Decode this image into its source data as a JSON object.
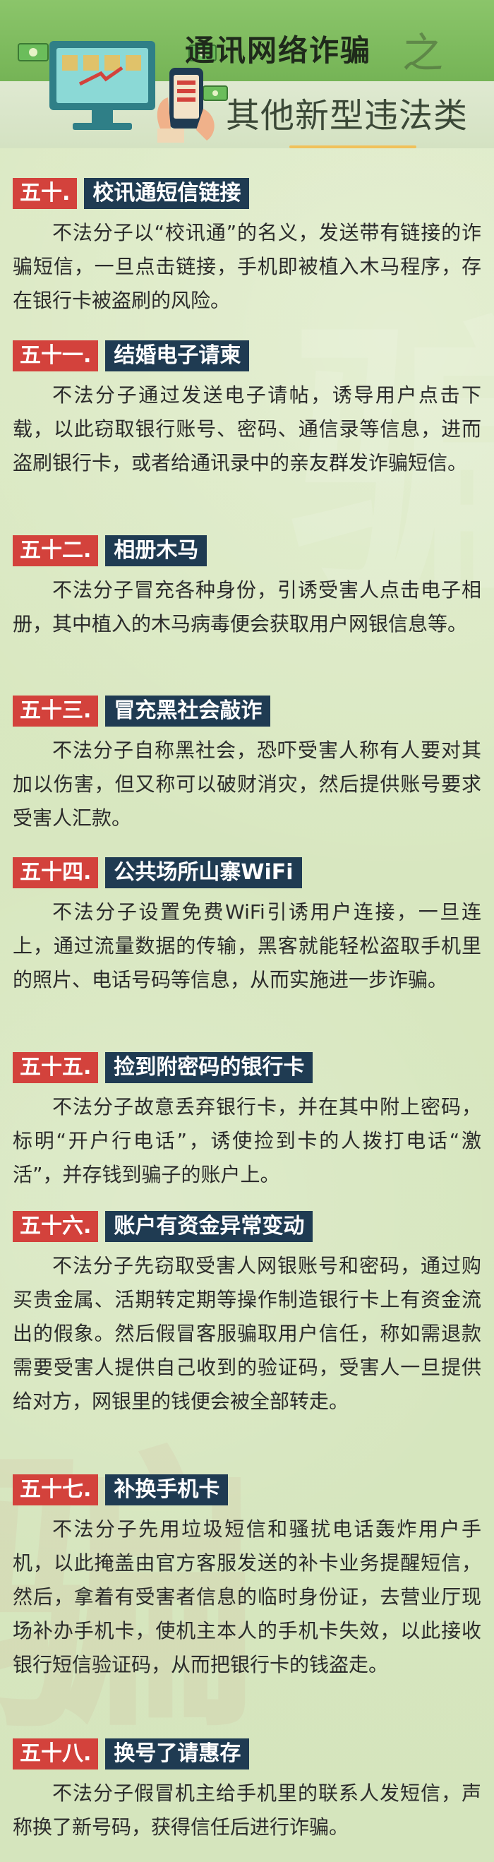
{
  "header": {
    "title_line_1": "通讯网络诈骗",
    "title_decor": "之",
    "title_line_2": "其他新型违法类"
  },
  "sections": [
    {
      "number": "五十.",
      "title": "校讯通短信链接",
      "body": "不法分子以“校讯通”的名义，发送带有链接的诈骗短信，一旦点击链接，手机即被植入木马程序，存在银行卡被盗刷的风险。"
    },
    {
      "number": "五十一.",
      "title": "结婚电子请柬",
      "body": "不法分子通过发送电子请帖，诱导用户点击下载，以此窃取银行账号、密码、通信录等信息，进而盗刷银行卡，或者给通讯录中的亲友群发诈骗短信。"
    },
    {
      "number": "五十二.",
      "title": "相册木马",
      "body": "不法分子冒充各种身份，引诱受害人点击电子相册，其中植入的木马病毒便会获取用户网银信息等。"
    },
    {
      "number": "五十三.",
      "title": "冒充黑社会敲诈",
      "body": "不法分子自称黑社会，恐吓受害人称有人要对其加以伤害，但又称可以破财消灾，然后提供账号要求受害人汇款。"
    },
    {
      "number": "五十四.",
      "title": "公共场所山寨WiFi",
      "body": "不法分子设置免费WiFi引诱用户连接，一旦连上，通过流量数据的传输，黑客就能轻松盗取手机里的照片、电话号码等信息，从而实施进一步诈骗。"
    },
    {
      "number": "五十五.",
      "title": "捡到附密码的银行卡",
      "body": "不法分子故意丢弃银行卡，并在其中附上密码，标明“开户行电话”，诱使捡到卡的人拨打电话“激活”，并存钱到骗子的账户上。"
    },
    {
      "number": "五十六.",
      "title": "账户有资金异常变动",
      "body": "不法分子先窃取受害人网银账号和密码，通过购买贵金属、活期转定期等操作制造银行卡上有资金流出的假象。然后假冒客服骗取用户信任，称如需退款需要受害人提供自己收到的验证码，受害人一旦提供给对方，网银里的钱便会被全部转走。"
    },
    {
      "number": "五十七.",
      "title": "补换手机卡",
      "body": "不法分子先用垃圾短信和骚扰电话轰炸用户手机，以此掩盖由官方客服发送的补卡业务提醒短信，然后，拿着有受害者信息的临时身份证，去营业厅现场补办手机卡，使机主本人的手机卡失效，以此接收银行短信验证码，从而把银行卡的钱盗走。"
    },
    {
      "number": "五十八.",
      "title": "换号了请惠存",
      "body": "不法分子假冒机主给手机里的联系人发短信，声称换了新号码，获得信任后进行诈骗。"
    }
  ]
}
